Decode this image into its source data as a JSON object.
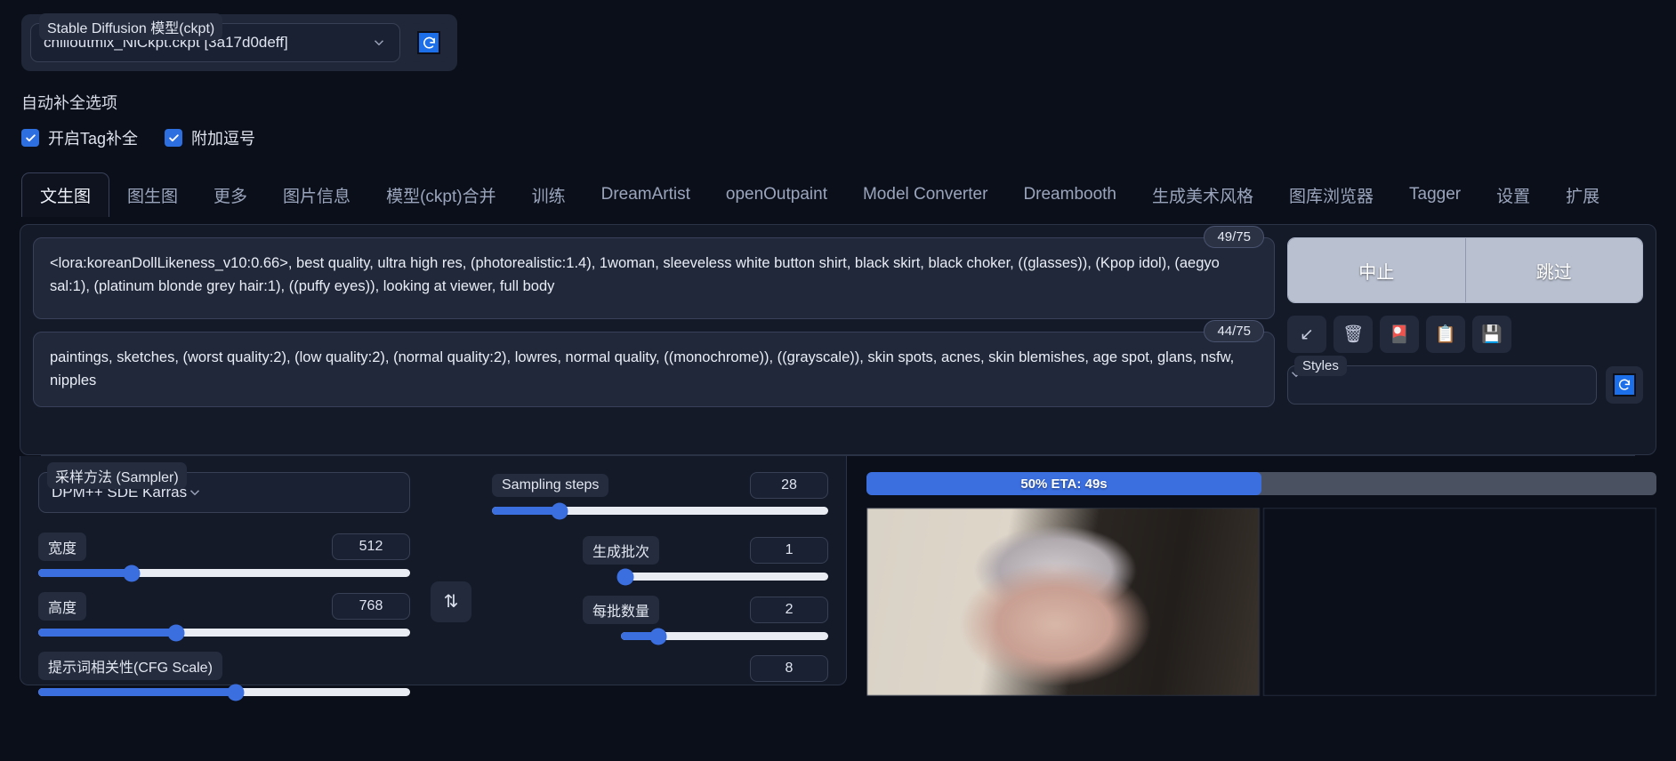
{
  "topbar": {
    "model_label": "Stable Diffusion 模型(ckpt)",
    "model_value": "chilloutmix_NiCkpt.ckpt [3a17d0deff]",
    "refresh_icon": "refresh-icon"
  },
  "autocomplete": {
    "title": "自动补全选项",
    "options": [
      {
        "label": "开启Tag补全",
        "checked": true
      },
      {
        "label": "附加逗号",
        "checked": true
      }
    ]
  },
  "tabs": [
    {
      "label": "文生图",
      "active": true
    },
    {
      "label": "图生图",
      "active": false
    },
    {
      "label": "更多",
      "active": false
    },
    {
      "label": "图片信息",
      "active": false
    },
    {
      "label": "模型(ckpt)合并",
      "active": false
    },
    {
      "label": "训练",
      "active": false
    },
    {
      "label": "DreamArtist",
      "active": false
    },
    {
      "label": "openOutpaint",
      "active": false
    },
    {
      "label": "Model Converter",
      "active": false
    },
    {
      "label": "Dreambooth",
      "active": false
    },
    {
      "label": "生成美术风格",
      "active": false
    },
    {
      "label": "图库浏览器",
      "active": false
    },
    {
      "label": "Tagger",
      "active": false
    },
    {
      "label": "设置",
      "active": false
    },
    {
      "label": "扩展",
      "active": false
    }
  ],
  "prompt": {
    "text": "<lora:koreanDollLikeness_v10:0.66>, best quality, ultra high res, (photorealistic:1.4), 1woman, sleeveless white button shirt, black skirt, black choker, ((glasses)), (Kpop idol), (aegyo sal:1), (platinum blonde grey hair:1), ((puffy eyes)), looking at viewer, full body",
    "token_count": "49/75"
  },
  "negative_prompt": {
    "text": "paintings, sketches, (worst quality:2), (low quality:2), (normal quality:2), lowres, normal quality, ((monochrome)), ((grayscale)), skin spots, acnes, skin blemishes, age spot, glans, nsfw, nipples",
    "token_count": "44/75"
  },
  "actions": {
    "interrupt_label": "中止",
    "skip_label": "跳过",
    "icon_buttons": [
      {
        "name": "restore-progress-icon",
        "glyph": "↙"
      },
      {
        "name": "trash-icon",
        "glyph": "🗑"
      },
      {
        "name": "extra-networks-icon",
        "glyph": "🎴"
      },
      {
        "name": "clipboard-icon",
        "glyph": "📋"
      },
      {
        "name": "save-style-icon",
        "glyph": "💾"
      }
    ],
    "styles_label": "Styles",
    "styles_value": "",
    "styles_refresh_icon": "refresh-icon"
  },
  "settings": {
    "sampler": {
      "label": "采样方法 (Sampler)",
      "value": "DPM++ SDE Karras"
    },
    "sliders": [
      {
        "name": "width",
        "label": "宽度",
        "value": "512",
        "percent": 25
      },
      {
        "name": "height",
        "label": "高度",
        "value": "768",
        "percent": 37
      },
      {
        "name": "cfg",
        "label": "提示词相关性(CFG Scale)",
        "value": "8",
        "percent": 53
      }
    ],
    "steps": {
      "label": "Sampling steps",
      "value": "28",
      "percent": 20
    },
    "batch_count": {
      "label": "生成批次",
      "value": "1",
      "percent": 2
    },
    "batch_size": {
      "label": "每批数量",
      "value": "2",
      "percent": 18
    },
    "swap_icon": "swap-dimensions-icon"
  },
  "result": {
    "progress_text": "50% ETA: 49s",
    "progress_percent": 50,
    "gallery": [
      {
        "name": "preview-image-1",
        "alt": "generated portrait 1"
      },
      {
        "name": "preview-image-2",
        "alt": "generated portrait 2"
      }
    ]
  },
  "colors": {
    "accent_blue": "#3b6fe0",
    "page_bg": "#0b0f19",
    "panel_bg": "#141a28",
    "field_bg": "#1a2132"
  }
}
